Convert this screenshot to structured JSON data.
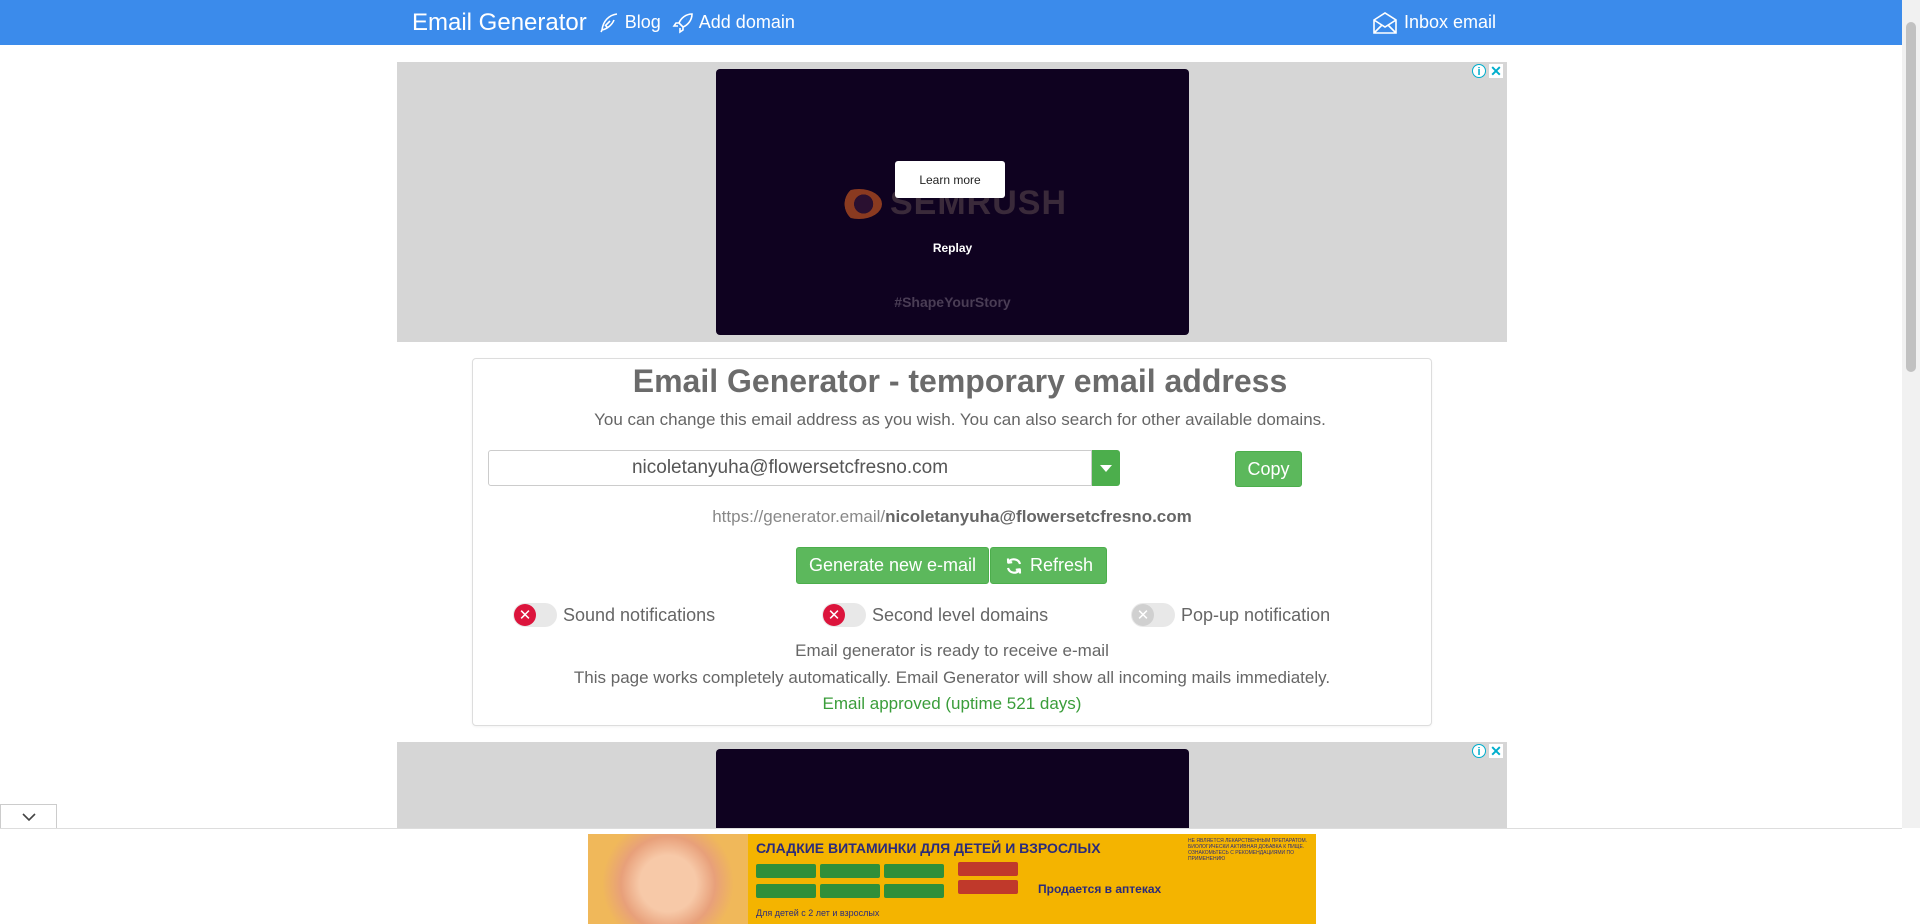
{
  "navbar": {
    "brand": "Email Generator",
    "blog_label": "Blog",
    "add_domain_label": "Add domain",
    "inbox_label": "Inbox email"
  },
  "ad_top": {
    "learn_more": "Learn more",
    "brand": "SEMRUSH",
    "replay": "Replay",
    "hashtag": "#ShapeYourStory"
  },
  "main": {
    "title": "Email Generator - temporary email address",
    "subtitle": "You can change this email address as you wish. You can also search for other available domains.",
    "email_value": "nicoletanyuha@flowersetcfresno.com",
    "copy_label": "Copy",
    "url_prefix": "https://generator.email/",
    "url_email": "nicoletanyuha@flowersetcfresno.com",
    "generate_label": "Generate new e-mail",
    "refresh_label": "Refresh",
    "toggles": {
      "sound": "Sound notifications",
      "second_level": "Second level domains",
      "popup": "Pop-up notification"
    },
    "status_ready": "Email generator is ready to receive e-mail",
    "status_auto": "This page works completely automatically. Email Generator will show all incoming mails immediately.",
    "status_approved": "Email approved (uptime 521 days)"
  },
  "bottom_ad": {
    "headline": "СЛАДКИЕ ВИТАМИНКИ ДЛЯ ДЕТЕЙ И ВЗРОСЛЫХ",
    "sub1": "Продается в аптеках",
    "sub2": "Для детей с 2 лет и взрослых",
    "fine": "НЕ ЯВЛЯЕТСЯ ЛЕКАРСТВЕННЫМ ПРЕПАРАТОМ. БИОЛОГИЧЕСКИ АКТИВНАЯ ДОБАВКА К ПИЩЕ. ОЗНАКОМЬТЕСЬ С РЕКОМЕНДАЦИЯМИ ПО ПРИМЕНЕНИЮ"
  },
  "colors": {
    "navbar": "#3b8beb",
    "button_green": "#5cb85c",
    "toggle_off_red": "#dc143c",
    "status_ok": "#3a9d3a"
  }
}
